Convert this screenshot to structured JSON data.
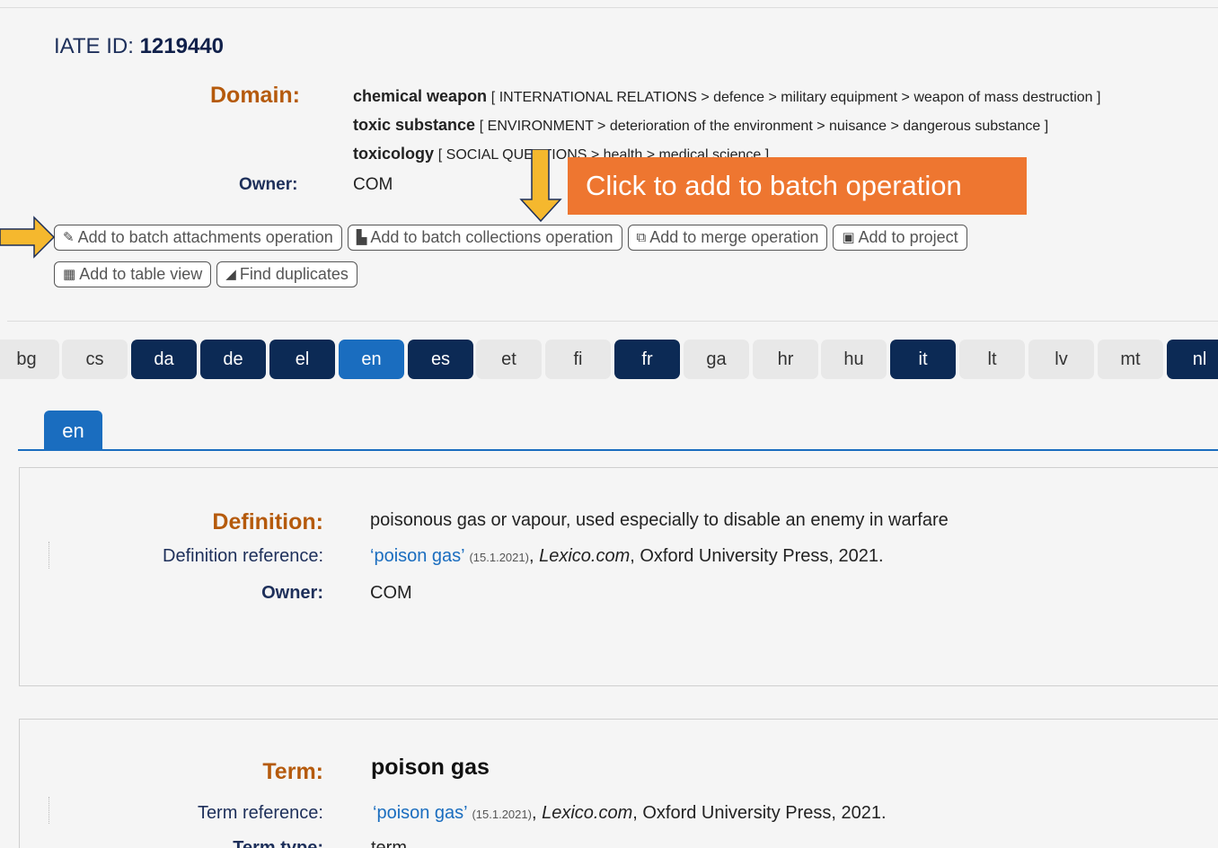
{
  "header": {
    "iate_id_label": "IATE ID:",
    "iate_id": "1219440"
  },
  "domain": {
    "label": "Domain:",
    "entries": [
      {
        "name": "chemical weapon",
        "path": "[ INTERNATIONAL RELATIONS > defence > military equipment > weapon of mass destruction ]"
      },
      {
        "name": "toxic substance",
        "path": "[ ENVIRONMENT > deterioration of the environment > nuisance > dangerous substance ]"
      },
      {
        "name": "toxicology",
        "path": "[ SOCIAL QUESTIONS > health > medical science ]"
      }
    ]
  },
  "owner": {
    "label": "Owner:",
    "value": "COM"
  },
  "callout": "Click to add to batch operation",
  "actions": {
    "batch_attachments": "Add to batch attachments operation",
    "batch_collections": "Add to batch collections operation",
    "merge": "Add to merge operation",
    "project": "Add to project",
    "table_view": "Add to table view",
    "find_duplicates": "Find duplicates"
  },
  "languages": [
    "bg",
    "cs",
    "da",
    "de",
    "el",
    "en",
    "es",
    "et",
    "fi",
    "fr",
    "ga",
    "hr",
    "hu",
    "it",
    "lt",
    "lv",
    "mt",
    "nl"
  ],
  "language_tab": "en",
  "definition_panel": {
    "definition_label": "Definition:",
    "definition_value": "poisonous gas or vapour, used especially to disable an enemy in warfare",
    "reference_label": "Definition reference:",
    "reference_link": "‘poison gas’",
    "reference_date": "(15.1.2021)",
    "reference_source": "Lexico.com",
    "reference_rest": ", Oxford University Press, 2021.",
    "owner_label": "Owner:",
    "owner_value": "COM"
  },
  "term_panel": {
    "term_label": "Term:",
    "term_value": "poison gas",
    "reference_label": "Term reference:",
    "reference_link": "‘poison gas’",
    "reference_date": "(15.1.2021)",
    "reference_source": "Lexico.com",
    "reference_rest": ", Oxford University Press, 2021.",
    "type_label": "Term type:",
    "type_value": "term"
  },
  "colors": {
    "accent_orange": "#ee7630",
    "brand_dark": "#0c2a55",
    "brand_blue": "#1a6dbf",
    "label_orange": "#b55a0c"
  }
}
